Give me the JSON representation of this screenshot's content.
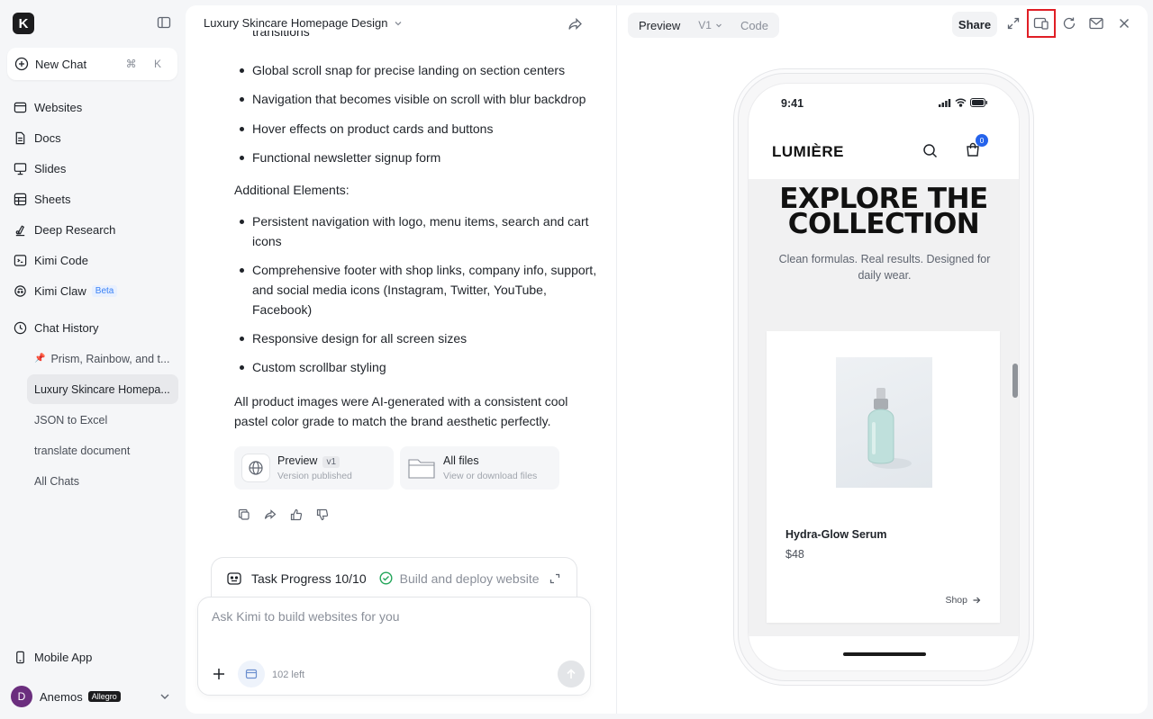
{
  "sidebar": {
    "logo_letter": "K",
    "new_chat": {
      "label": "New Chat",
      "shortcut": "⌘ K"
    },
    "nav": [
      {
        "label": "Websites",
        "icon": "websites-icon"
      },
      {
        "label": "Docs",
        "icon": "docs-icon"
      },
      {
        "label": "Slides",
        "icon": "slides-icon"
      },
      {
        "label": "Sheets",
        "icon": "sheets-icon"
      },
      {
        "label": "Deep Research",
        "icon": "deep-research-icon"
      },
      {
        "label": "Kimi Code",
        "icon": "code-icon"
      },
      {
        "label": "Kimi Claw",
        "icon": "claw-icon",
        "badge": "Beta"
      }
    ],
    "chat_history_label": "Chat History",
    "history": [
      {
        "label": "Prism, Rainbow, and t...",
        "pinned": true
      },
      {
        "label": "Luxury Skincare Homepa...",
        "active": true
      },
      {
        "label": "JSON to Excel"
      },
      {
        "label": "translate document"
      },
      {
        "label": "All Chats"
      }
    ],
    "mobile_app": "Mobile App",
    "user": {
      "initial": "D",
      "name": "Anemos",
      "plan": "Allegro"
    }
  },
  "chat": {
    "title": "Luxury Skincare Homepage Design",
    "partial_line": "transitions",
    "bullets_1": [
      "Global scroll snap for precise landing on section centers",
      "Navigation that becomes visible on scroll with blur backdrop",
      "Hover effects on product cards and buttons",
      "Functional newsletter signup form"
    ],
    "heading_additional": "Additional Elements:",
    "bullets_2": [
      "Persistent navigation with logo, menu items, search and cart icons",
      "Comprehensive footer with shop links, company info, support, and social media icons (Instagram, Twitter, YouTube, Facebook)",
      "Responsive design for all screen sizes",
      "Custom scrollbar styling"
    ],
    "closing": "All product images were AI-generated with a consistent cool pastel color grade to match the brand aesthetic perfectly.",
    "cards": {
      "preview": {
        "title": "Preview",
        "version": "v1",
        "subtitle": "Version published"
      },
      "files": {
        "title": "All files",
        "subtitle": "View or download files"
      }
    },
    "task_progress": {
      "label": "Task Progress 10/10",
      "status": "Build and deploy website"
    },
    "composer": {
      "placeholder": "Ask Kimi to build websites for you",
      "remaining": "102 left"
    }
  },
  "preview": {
    "tabs": {
      "preview": "Preview",
      "version": "V1",
      "code": "Code"
    },
    "share": "Share",
    "phone": {
      "time": "9:41",
      "brand": "LUMIÈRE",
      "cart_count": "0",
      "hero_title_1": "EXPLORE THE",
      "hero_title_2": "COLLECTION",
      "hero_sub": "Clean formulas. Real results. Designed for daily wear.",
      "product": {
        "name": "Hydra-Glow Serum",
        "price": "$48",
        "cta": "Shop"
      }
    }
  },
  "colors": {
    "accent": "#2563eb",
    "highlight": "#e01e25",
    "brand_dark": "#111111"
  }
}
